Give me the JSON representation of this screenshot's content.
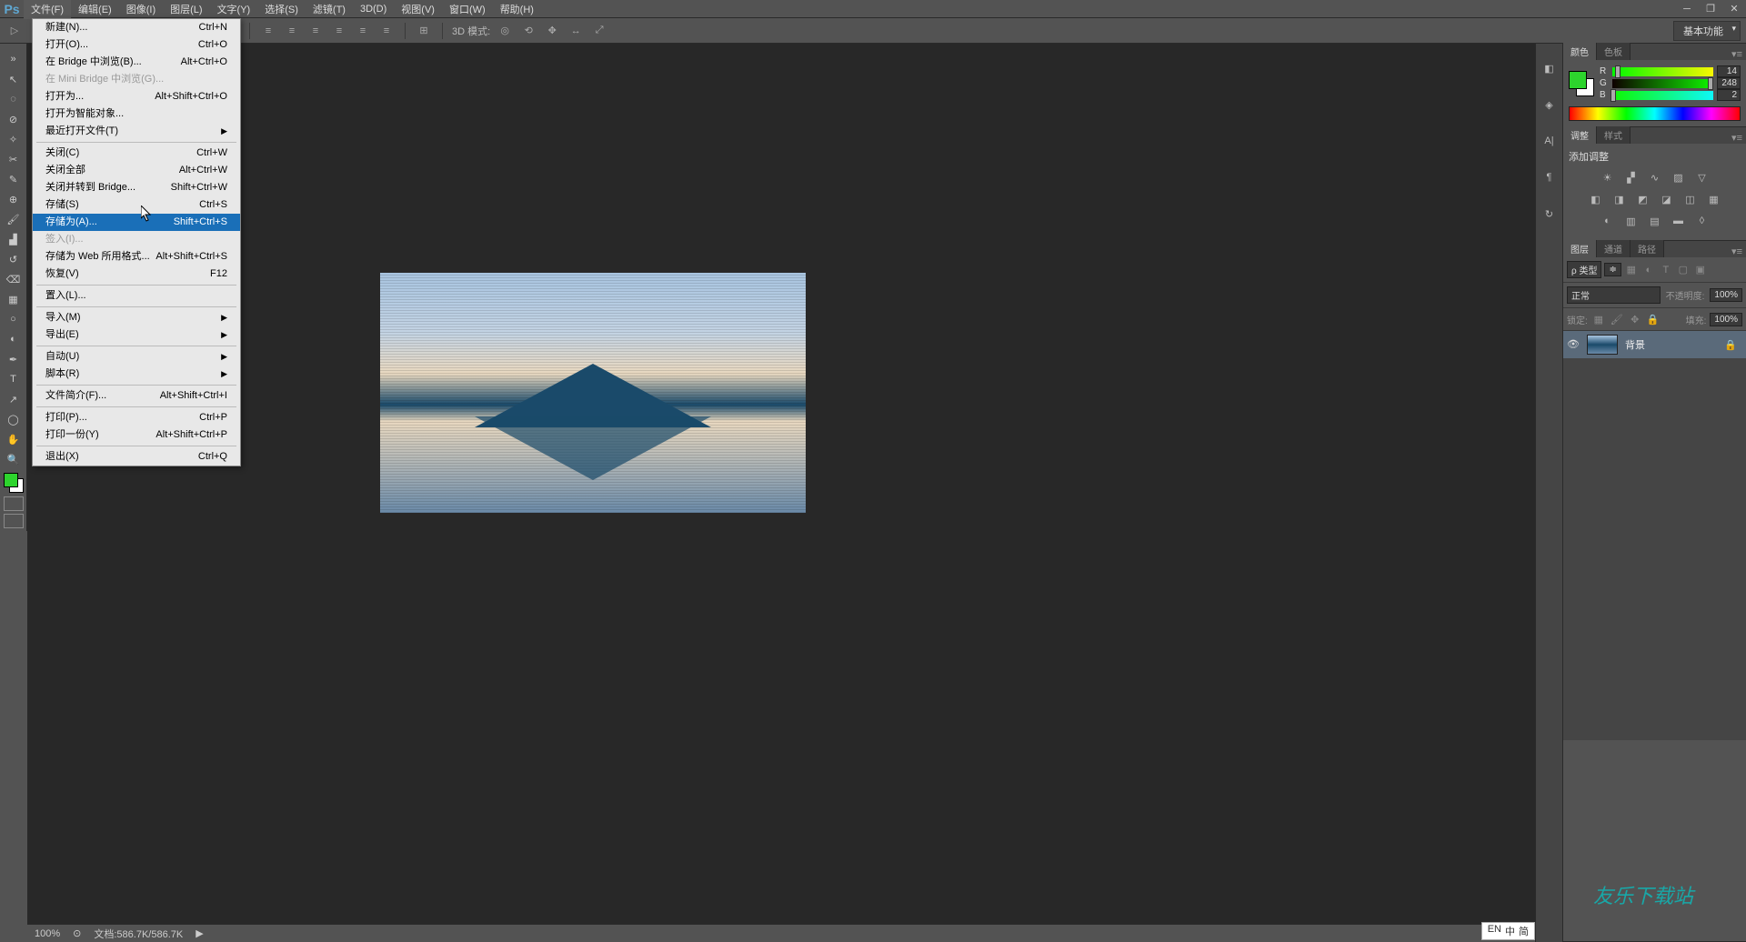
{
  "menubar": {
    "items": [
      "文件(F)",
      "编辑(E)",
      "图像(I)",
      "图层(L)",
      "文字(Y)",
      "选择(S)",
      "滤镜(T)",
      "3D(D)",
      "视图(V)",
      "窗口(W)",
      "帮助(H)"
    ]
  },
  "optionsbar": {
    "mode3d_label": "3D 模式:",
    "workspace": "基本功能"
  },
  "file_menu": {
    "new": {
      "label": "新建(N)...",
      "shortcut": "Ctrl+N"
    },
    "open": {
      "label": "打开(O)...",
      "shortcut": "Ctrl+O"
    },
    "browse_bridge": {
      "label": "在 Bridge 中浏览(B)...",
      "shortcut": "Alt+Ctrl+O"
    },
    "browse_mini": {
      "label": "在 Mini Bridge 中浏览(G)...",
      "shortcut": ""
    },
    "open_as": {
      "label": "打开为...",
      "shortcut": "Alt+Shift+Ctrl+O"
    },
    "open_smart": {
      "label": "打开为智能对象...",
      "shortcut": ""
    },
    "recent": {
      "label": "最近打开文件(T)",
      "shortcut": "▶"
    },
    "close": {
      "label": "关闭(C)",
      "shortcut": "Ctrl+W"
    },
    "close_all": {
      "label": "关闭全部",
      "shortcut": "Alt+Ctrl+W"
    },
    "close_bridge": {
      "label": "关闭并转到 Bridge...",
      "shortcut": "Shift+Ctrl+W"
    },
    "save": {
      "label": "存储(S)",
      "shortcut": "Ctrl+S"
    },
    "save_as": {
      "label": "存储为(A)...",
      "shortcut": "Shift+Ctrl+S"
    },
    "checkin": {
      "label": "签入(I)...",
      "shortcut": ""
    },
    "save_web": {
      "label": "存储为 Web 所用格式...",
      "shortcut": "Alt+Shift+Ctrl+S"
    },
    "revert": {
      "label": "恢复(V)",
      "shortcut": "F12"
    },
    "place": {
      "label": "置入(L)...",
      "shortcut": ""
    },
    "import": {
      "label": "导入(M)",
      "shortcut": "▶"
    },
    "export": {
      "label": "导出(E)",
      "shortcut": "▶"
    },
    "automate": {
      "label": "自动(U)",
      "shortcut": "▶"
    },
    "scripts": {
      "label": "脚本(R)",
      "shortcut": "▶"
    },
    "file_info": {
      "label": "文件简介(F)...",
      "shortcut": "Alt+Shift+Ctrl+I"
    },
    "print": {
      "label": "打印(P)...",
      "shortcut": "Ctrl+P"
    },
    "print_one": {
      "label": "打印一份(Y)",
      "shortcut": "Alt+Shift+Ctrl+P"
    },
    "exit": {
      "label": "退出(X)",
      "shortcut": "Ctrl+Q"
    }
  },
  "color_panel": {
    "tab_color": "颜色",
    "tab_swatch": "色板",
    "r": {
      "label": "R",
      "value": "14"
    },
    "g": {
      "label": "G",
      "value": "248"
    },
    "b": {
      "label": "B",
      "value": "2"
    }
  },
  "adjust_panel": {
    "tab_adjust": "调整",
    "tab_styles": "样式",
    "title": "添加调整"
  },
  "layers_panel": {
    "tab_layers": "图层",
    "tab_channels": "通道",
    "tab_paths": "路径",
    "kind": "ρ 类型",
    "blend": "正常",
    "opacity_label": "不透明度:",
    "opacity_val": "100%",
    "lock_label": "锁定:",
    "fill_label": "填充:",
    "fill_val": "100%",
    "layer_name": "背景"
  },
  "statusbar": {
    "zoom": "100%",
    "doc": "文档:586.7K/586.7K"
  },
  "ime": {
    "lang": "EN",
    "cn": "中",
    "pin": "简"
  }
}
